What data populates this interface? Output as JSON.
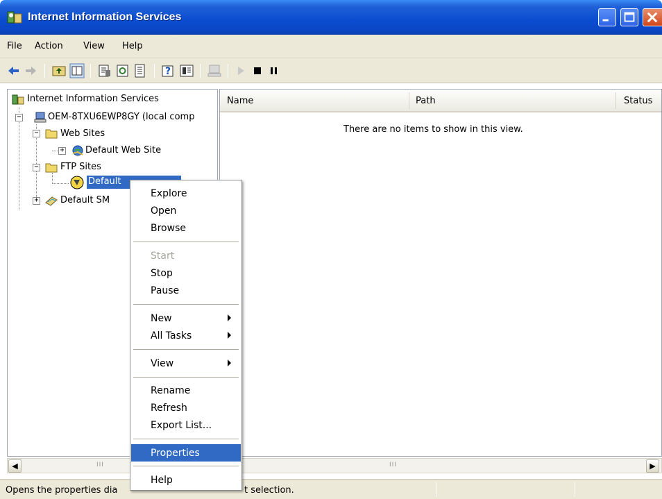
{
  "window": {
    "title": "Internet Information Services"
  },
  "menu": [
    "File",
    "Action",
    "View",
    "Help"
  ],
  "toolbar": {
    "icons": [
      "back-arrow-icon",
      "forward-arrow-icon",
      "up-folder-icon",
      "show-hide-tree-icon",
      "properties-icon",
      "refresh-icon",
      "export-list-icon",
      "help-icon",
      "show-hide-action-pane-icon",
      "computer-icon",
      "start-icon",
      "stop-icon",
      "pause-icon"
    ]
  },
  "tree": {
    "root": "Internet Information Services",
    "computer": "OEM-8TXU6EWP8GY (local comp",
    "web_sites": "Web Sites",
    "default_web_site": "Default Web Site",
    "ftp_sites": "FTP Sites",
    "default_ftp_site_visible": "Default",
    "default_smtp_visible": "Default SM"
  },
  "list": {
    "columns": [
      "Name",
      "Path",
      "Status"
    ],
    "empty_message": "There are no items to show in this view."
  },
  "context_menu": {
    "items": [
      {
        "label": "Explore",
        "enabled": true
      },
      {
        "label": "Open",
        "enabled": true
      },
      {
        "label": "Browse",
        "enabled": true
      },
      {
        "label": "Start",
        "enabled": false
      },
      {
        "label": "Stop",
        "enabled": true
      },
      {
        "label": "Pause",
        "enabled": true
      },
      {
        "label": "New",
        "enabled": true,
        "submenu": true
      },
      {
        "label": "All Tasks",
        "enabled": true,
        "submenu": true
      },
      {
        "label": "View",
        "enabled": true,
        "submenu": true
      },
      {
        "label": "Rename",
        "enabled": true
      },
      {
        "label": "Refresh",
        "enabled": true
      },
      {
        "label": "Export List...",
        "enabled": true
      },
      {
        "label": "Properties",
        "enabled": true,
        "selected": true
      },
      {
        "label": "Help",
        "enabled": true
      }
    ]
  },
  "status": {
    "text_left": "Opens the properties dia",
    "text_right": "t selection."
  },
  "colors": {
    "selection": "#316ac5",
    "titlebar": "#0b4cd0",
    "chrome": "#ece9d8"
  }
}
